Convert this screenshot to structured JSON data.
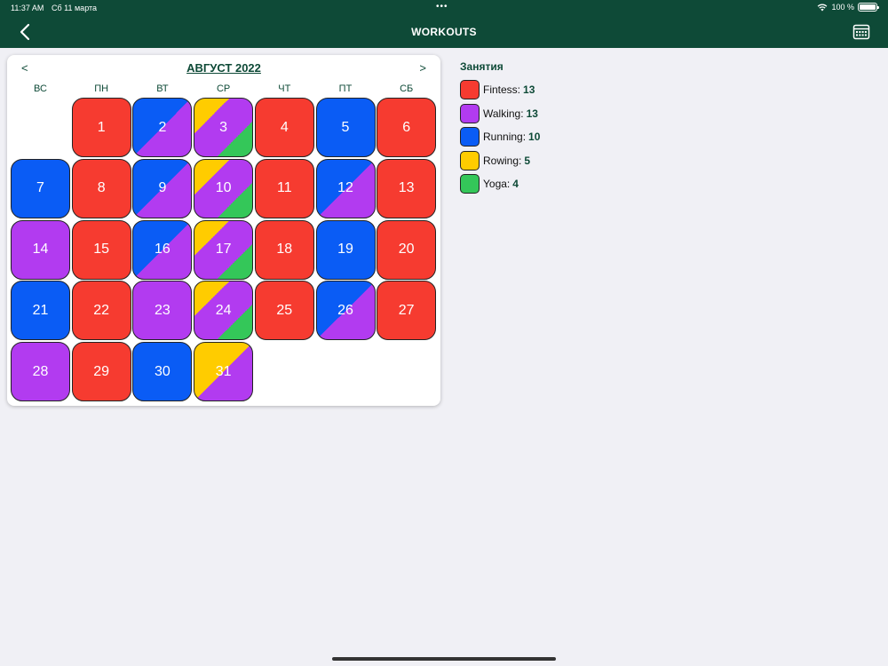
{
  "status": {
    "time": "11:37 AM",
    "date": "Сб 11 марта",
    "battery": "100 %",
    "dots": "•••"
  },
  "nav": {
    "title": "WORKOUTS",
    "back_icon": "chevron-left-icon",
    "calendar_icon": "calendar-icon"
  },
  "calendar": {
    "month": "АВГУСТ 2022",
    "prev": "<",
    "next": ">",
    "weekdays": [
      "ВС",
      "ПН",
      "ВТ",
      "СР",
      "ЧТ",
      "ПТ",
      "СБ"
    ],
    "first_weekday": 1,
    "days": [
      {
        "d": "1",
        "act": [
          "fitness"
        ]
      },
      {
        "d": "2",
        "act": [
          "running",
          "walking"
        ]
      },
      {
        "d": "3",
        "act": [
          "rowing",
          "walking",
          "yoga"
        ]
      },
      {
        "d": "4",
        "act": [
          "fitness"
        ]
      },
      {
        "d": "5",
        "act": [
          "running"
        ]
      },
      {
        "d": "6",
        "act": [
          "fitness"
        ]
      },
      {
        "d": "7",
        "act": [
          "running"
        ]
      },
      {
        "d": "8",
        "act": [
          "fitness"
        ]
      },
      {
        "d": "9",
        "act": [
          "running",
          "walking"
        ]
      },
      {
        "d": "10",
        "act": [
          "rowing",
          "walking",
          "yoga"
        ]
      },
      {
        "d": "11",
        "act": [
          "fitness"
        ]
      },
      {
        "d": "12",
        "act": [
          "running",
          "walking"
        ]
      },
      {
        "d": "13",
        "act": [
          "fitness"
        ]
      },
      {
        "d": "14",
        "act": [
          "walking"
        ]
      },
      {
        "d": "15",
        "act": [
          "fitness"
        ]
      },
      {
        "d": "16",
        "act": [
          "running",
          "walking"
        ]
      },
      {
        "d": "17",
        "act": [
          "rowing",
          "walking",
          "yoga"
        ]
      },
      {
        "d": "18",
        "act": [
          "fitness"
        ]
      },
      {
        "d": "19",
        "act": [
          "running"
        ]
      },
      {
        "d": "20",
        "act": [
          "fitness"
        ]
      },
      {
        "d": "21",
        "act": [
          "running"
        ]
      },
      {
        "d": "22",
        "act": [
          "fitness"
        ]
      },
      {
        "d": "23",
        "act": [
          "walking"
        ]
      },
      {
        "d": "24",
        "act": [
          "rowing",
          "walking",
          "yoga"
        ]
      },
      {
        "d": "25",
        "act": [
          "fitness"
        ]
      },
      {
        "d": "26",
        "act": [
          "running",
          "walking"
        ]
      },
      {
        "d": "27",
        "act": [
          "fitness"
        ]
      },
      {
        "d": "28",
        "act": [
          "walking"
        ]
      },
      {
        "d": "29",
        "act": [
          "fitness"
        ]
      },
      {
        "d": "30",
        "act": [
          "running"
        ]
      },
      {
        "d": "31",
        "act": [
          "rowing",
          "walking"
        ]
      }
    ]
  },
  "legend": {
    "title": "Занятия",
    "items": [
      {
        "key": "fitness",
        "label": "Fintess:",
        "count": "13",
        "color": "#f63b30"
      },
      {
        "key": "walking",
        "label": "Walking:",
        "count": "13",
        "color": "#b23bf0"
      },
      {
        "key": "running",
        "label": "Running:",
        "count": "10",
        "color": "#0a5cf5"
      },
      {
        "key": "rowing",
        "label": "Rowing:",
        "count": "5",
        "color": "#ffcc00"
      },
      {
        "key": "yoga",
        "label": "Yoga:",
        "count": "4",
        "color": "#34c759"
      }
    ]
  }
}
